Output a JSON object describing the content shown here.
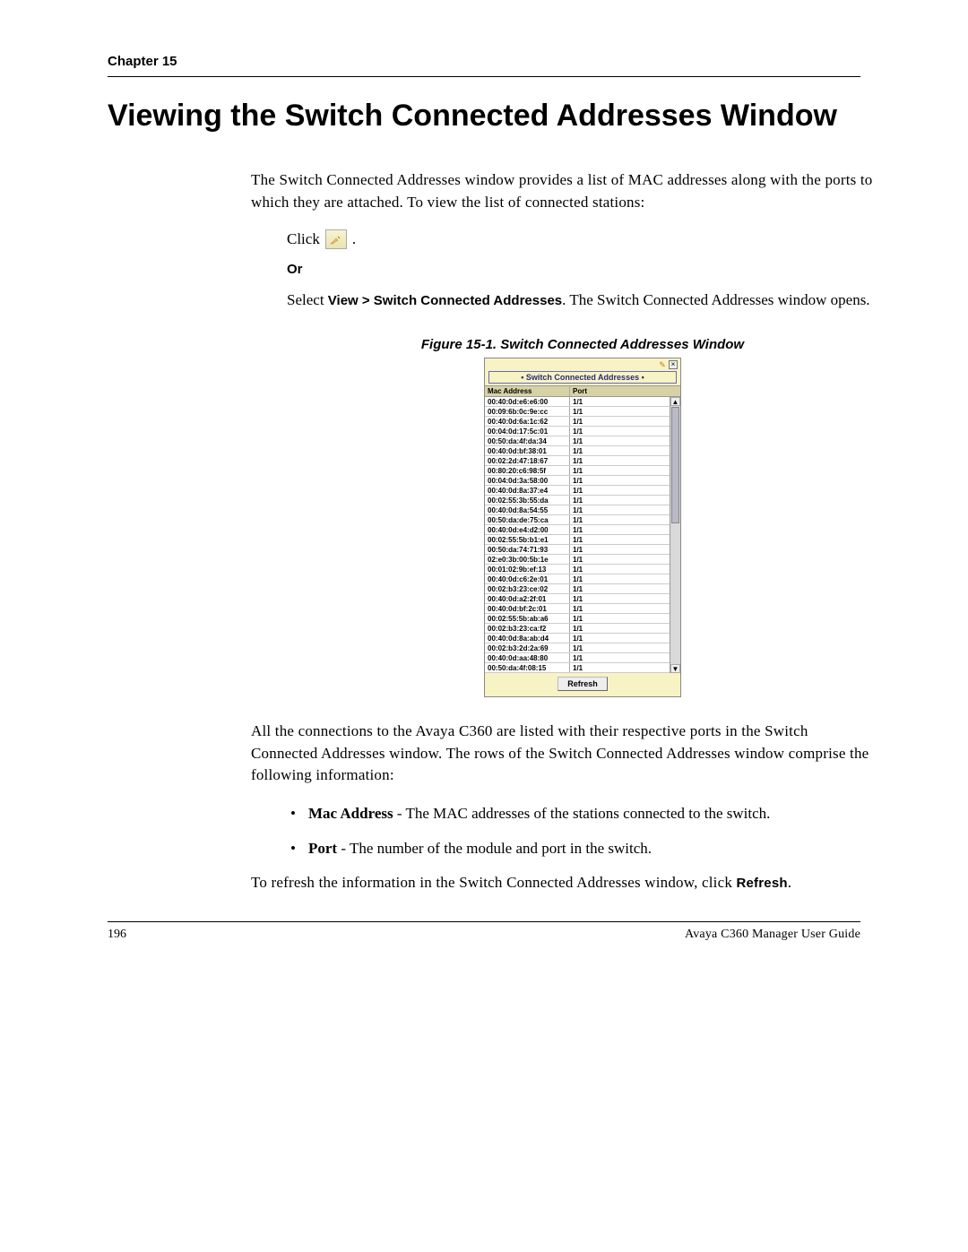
{
  "header": {
    "chapter": "Chapter 15"
  },
  "title": "Viewing the Switch Connected Addresses Window",
  "intro": "The Switch Connected Addresses window provides a list of MAC addresses along with the ports to which they are attached. To view the list of connected stations:",
  "click": {
    "label": "Click",
    "period": "."
  },
  "or": "Or",
  "select_line": {
    "prefix": "Select ",
    "menu_path": "View > Switch Connected Addresses",
    "suffix": ". The Switch Connected Addresses window opens."
  },
  "figure": {
    "caption": "Figure 15-1. Switch Connected Addresses Window",
    "window_title": "• Switch Connected Addresses •",
    "columns": {
      "mac": "Mac Address",
      "port": "Port"
    },
    "rows": [
      {
        "mac": "00:40:0d:e6:e6:00",
        "port": "1/1"
      },
      {
        "mac": "00:09:6b:0c:9e:cc",
        "port": "1/1"
      },
      {
        "mac": "00:40:0d:6a:1c:62",
        "port": "1/1"
      },
      {
        "mac": "00:04:0d:17:5c:01",
        "port": "1/1"
      },
      {
        "mac": "00:50:da:4f:da:34",
        "port": "1/1"
      },
      {
        "mac": "00:40:0d:bf:38:01",
        "port": "1/1"
      },
      {
        "mac": "00:02:2d:47:18:67",
        "port": "1/1"
      },
      {
        "mac": "00:80:20:c6:98:5f",
        "port": "1/1"
      },
      {
        "mac": "00:04:0d:3a:58:00",
        "port": "1/1"
      },
      {
        "mac": "00:40:0d:8a:37:e4",
        "port": "1/1"
      },
      {
        "mac": "00:02:55:3b:55:da",
        "port": "1/1"
      },
      {
        "mac": "00:40:0d:8a:54:55",
        "port": "1/1"
      },
      {
        "mac": "00:50:da:de:75:ca",
        "port": "1/1"
      },
      {
        "mac": "00:40:0d:e4:d2:00",
        "port": "1/1"
      },
      {
        "mac": "00:02:55:5b:b1:e1",
        "port": "1/1"
      },
      {
        "mac": "00:50:da:74:71:93",
        "port": "1/1"
      },
      {
        "mac": "02:e0:3b:00:5b:1e",
        "port": "1/1"
      },
      {
        "mac": "00:01:02:9b:ef:13",
        "port": "1/1"
      },
      {
        "mac": "00:40:0d:c6:2e:01",
        "port": "1/1"
      },
      {
        "mac": "00:02:b3:23:ce:02",
        "port": "1/1"
      },
      {
        "mac": "00:40:0d:a2:2f:01",
        "port": "1/1"
      },
      {
        "mac": "00:40:0d:bf:2c:01",
        "port": "1/1"
      },
      {
        "mac": "00:02:55:5b:ab:a6",
        "port": "1/1"
      },
      {
        "mac": "00:02:b3:23:ca:f2",
        "port": "1/1"
      },
      {
        "mac": "00:40:0d:8a:ab:d4",
        "port": "1/1"
      },
      {
        "mac": "00:02:b3:2d:2a:69",
        "port": "1/1"
      },
      {
        "mac": "00:40:0d:aa:48:80",
        "port": "1/1"
      },
      {
        "mac": "00:50:da:4f:08:15",
        "port": "1/1"
      }
    ],
    "refresh": "Refresh"
  },
  "after_fig": "All the connections to the Avaya C360 are listed with their respective ports in the Switch Connected Addresses window. The rows of the Switch Connected Addresses window comprise the following information:",
  "bullets": [
    {
      "term": "Mac Address",
      "desc": " - The MAC addresses of the stations connected to the switch."
    },
    {
      "term": "Port",
      "desc": " - The number of the module and port in the switch."
    }
  ],
  "refresh_para": {
    "prefix": "To refresh the information in the Switch Connected Addresses window, click ",
    "bold": "Refresh",
    "suffix": "."
  },
  "footer": {
    "page": "196",
    "guide": "Avaya C360 Manager User Guide"
  }
}
